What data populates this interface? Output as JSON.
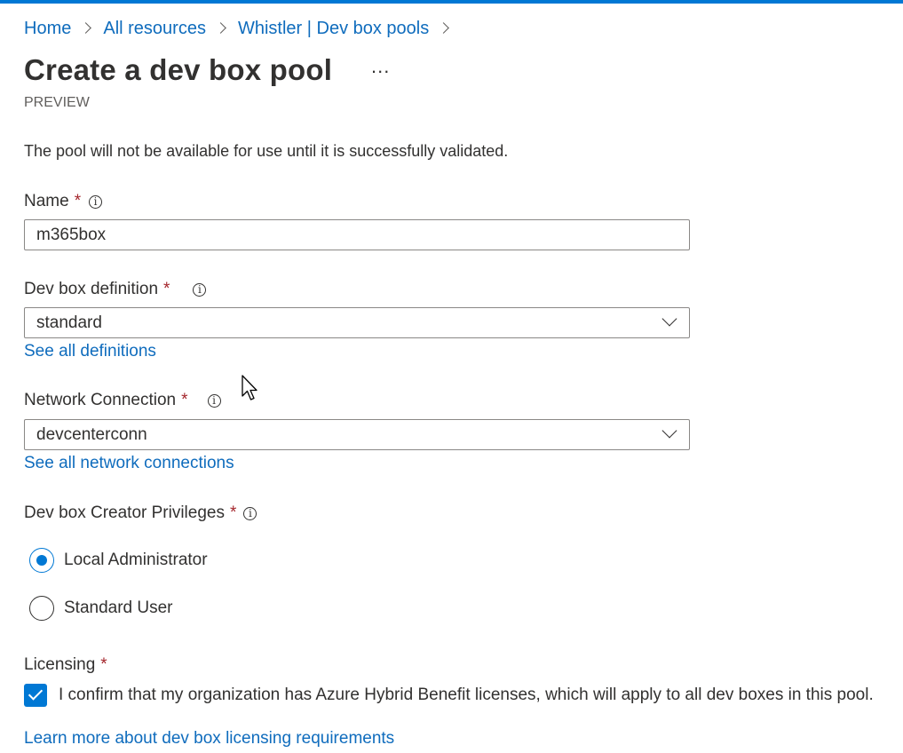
{
  "breadcrumb": {
    "items": [
      "Home",
      "All resources",
      "Whistler | Dev box pools"
    ]
  },
  "header": {
    "title": "Create a dev box pool",
    "more_label": "...",
    "subtitle": "PREVIEW"
  },
  "notice": "The pool will not be available for use until it is successfully validated.",
  "form": {
    "name": {
      "label": "Name",
      "required_mark": "*",
      "value": "m365box"
    },
    "definition": {
      "label": "Dev box definition",
      "required_mark": "*",
      "selected": "standard",
      "link": "See all definitions"
    },
    "network": {
      "label": "Network Connection",
      "required_mark": "*",
      "selected": "devcenterconn",
      "link": "See all network connections"
    },
    "privileges": {
      "label": "Dev box Creator Privileges",
      "required_mark": "*",
      "options": [
        {
          "label": "Local Administrator",
          "selected": true
        },
        {
          "label": "Standard User",
          "selected": false
        }
      ]
    },
    "licensing": {
      "label": "Licensing",
      "required_mark": "*",
      "checkbox_label": "I confirm that my organization has Azure Hybrid Benefit licenses, which will apply to all dev boxes in this pool.",
      "checked": true,
      "link": "Learn more about dev box licensing requirements"
    }
  },
  "icons": {
    "info": "info-icon",
    "chevron": "chevron-down-icon",
    "cursor": "mouse-pointer-icon"
  },
  "colors": {
    "accent": "#0078d4",
    "link": "#0f6cbd",
    "required": "#a4262c",
    "text": "#323130"
  }
}
